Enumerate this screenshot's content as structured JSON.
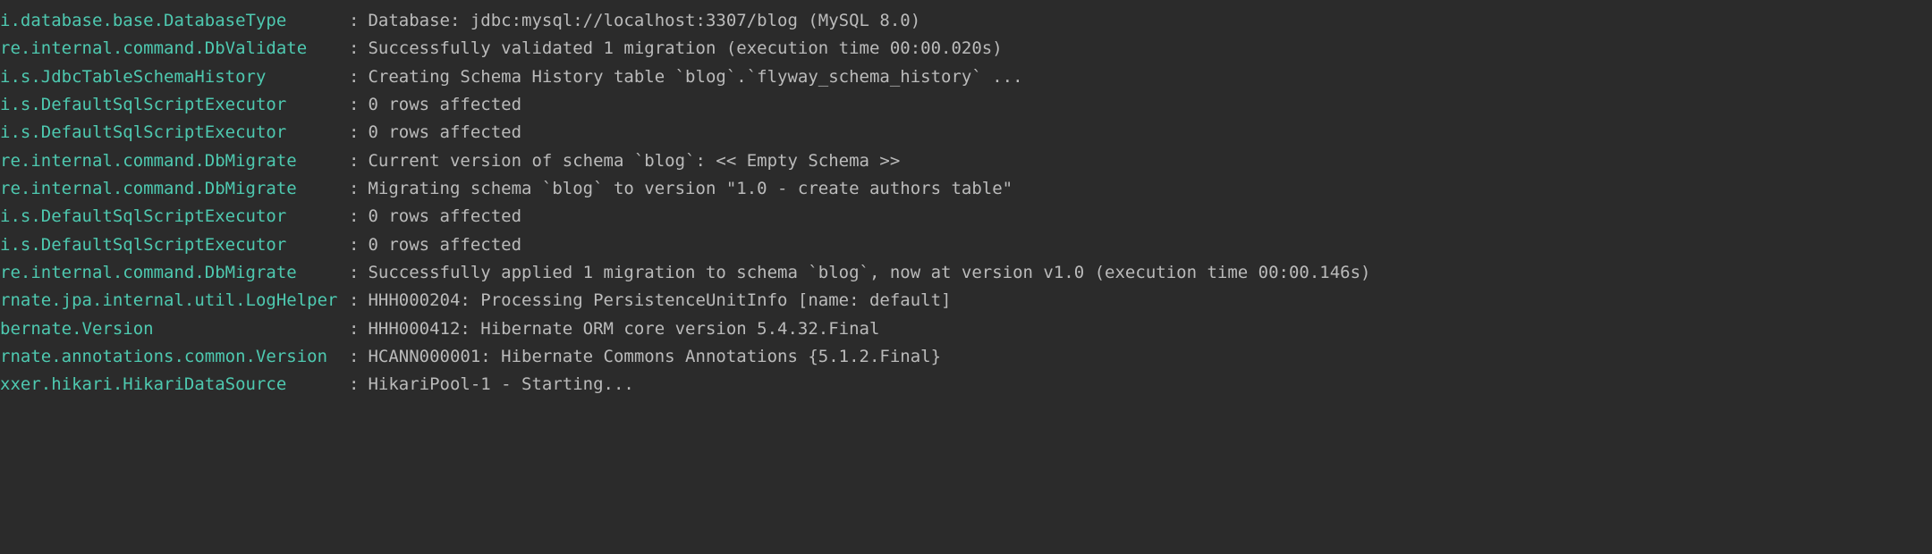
{
  "separator": ":",
  "log_lines": [
    {
      "logger": "i.database.base.DatabaseType",
      "message": "Database: jdbc:mysql://localhost:3307/blog (MySQL 8.0)"
    },
    {
      "logger": "re.internal.command.DbValidate",
      "message": "Successfully validated 1 migration (execution time 00:00.020s)"
    },
    {
      "logger": "i.s.JdbcTableSchemaHistory",
      "message": "Creating Schema History table `blog`.`flyway_schema_history` ..."
    },
    {
      "logger": "i.s.DefaultSqlScriptExecutor",
      "message": "0 rows affected"
    },
    {
      "logger": "i.s.DefaultSqlScriptExecutor",
      "message": "0 rows affected"
    },
    {
      "logger": "re.internal.command.DbMigrate",
      "message": "Current version of schema `blog`: << Empty Schema >>"
    },
    {
      "logger": "re.internal.command.DbMigrate",
      "message": "Migrating schema `blog` to version \"1.0 - create authors table\""
    },
    {
      "logger": "i.s.DefaultSqlScriptExecutor",
      "message": "0 rows affected"
    },
    {
      "logger": "i.s.DefaultSqlScriptExecutor",
      "message": "0 rows affected"
    },
    {
      "logger": "re.internal.command.DbMigrate",
      "message": "Successfully applied 1 migration to schema `blog`, now at version v1.0 (execution time 00:00.146s)"
    },
    {
      "logger": "rnate.jpa.internal.util.LogHelper",
      "message": "HHH000204: Processing PersistenceUnitInfo [name: default]"
    },
    {
      "logger": "bernate.Version",
      "message": "HHH000412: Hibernate ORM core version 5.4.32.Final"
    },
    {
      "logger": "rnate.annotations.common.Version",
      "message": "HCANN000001: Hibernate Commons Annotations {5.1.2.Final}"
    },
    {
      "logger": "xxer.hikari.HikariDataSource",
      "message": "HikariPool-1 - Starting..."
    }
  ]
}
